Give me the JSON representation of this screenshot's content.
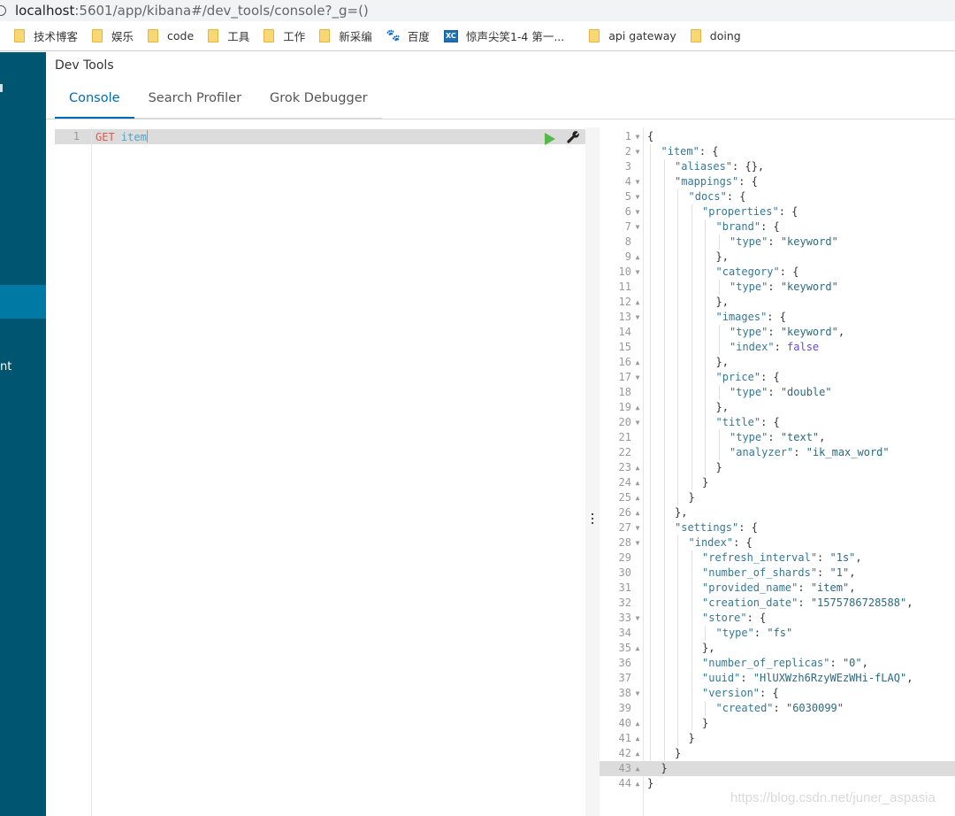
{
  "browser": {
    "url_host": "localhost",
    "url_path": ":5601/app/kibana#/dev_tools/console?_g=()",
    "bookmarks": [
      {
        "label": "技术博客",
        "icon": "folder-icon"
      },
      {
        "label": "娱乐",
        "icon": "folder-icon"
      },
      {
        "label": "code",
        "icon": "folder-icon"
      },
      {
        "label": "工具",
        "icon": "folder-icon"
      },
      {
        "label": "工作",
        "icon": "folder-icon"
      },
      {
        "label": "新采编",
        "icon": "folder-icon"
      },
      {
        "label": "百度",
        "icon": "baidu-paw-icon"
      },
      {
        "label": "惊声尖笑1-4 第一...",
        "icon": "xc-site-icon"
      },
      {
        "label": "api gateway",
        "icon": "folder-icon"
      },
      {
        "label": "doing",
        "icon": "folder-icon"
      }
    ]
  },
  "sidebar": {
    "partial_label": "nt",
    "accent": "#005571",
    "active_color": "#0079a5"
  },
  "header": {
    "title": "Dev Tools",
    "tabs": [
      {
        "label": "Console",
        "active": true
      },
      {
        "label": "Search Profiler",
        "active": false
      },
      {
        "label": "Grok Debugger",
        "active": false
      }
    ]
  },
  "editor": {
    "line_number": "1",
    "method": "GET",
    "path": "item",
    "run_icon": "play-icon",
    "settings_icon": "wrench-icon"
  },
  "output": {
    "lines": [
      {
        "n": "1",
        "fold": "down",
        "indent": 0,
        "parts": [
          [
            "p",
            "{"
          ]
        ]
      },
      {
        "n": "2",
        "fold": "down",
        "indent": 1,
        "parts": [
          [
            "k",
            "\"item\""
          ],
          [
            "p",
            ": {"
          ]
        ]
      },
      {
        "n": "3",
        "fold": "",
        "indent": 2,
        "parts": [
          [
            "k",
            "\"aliases\""
          ],
          [
            "p",
            ": {},"
          ]
        ]
      },
      {
        "n": "4",
        "fold": "down",
        "indent": 2,
        "parts": [
          [
            "k",
            "\"mappings\""
          ],
          [
            "p",
            ": {"
          ]
        ]
      },
      {
        "n": "5",
        "fold": "down",
        "indent": 3,
        "parts": [
          [
            "k",
            "\"docs\""
          ],
          [
            "p",
            ": {"
          ]
        ]
      },
      {
        "n": "6",
        "fold": "down",
        "indent": 4,
        "parts": [
          [
            "k",
            "\"properties\""
          ],
          [
            "p",
            ": {"
          ]
        ]
      },
      {
        "n": "7",
        "fold": "down",
        "indent": 5,
        "parts": [
          [
            "k",
            "\"brand\""
          ],
          [
            "p",
            ": {"
          ]
        ]
      },
      {
        "n": "8",
        "fold": "",
        "indent": 6,
        "parts": [
          [
            "k",
            "\"type\""
          ],
          [
            "p",
            ": "
          ],
          [
            "s",
            "\"keyword\""
          ]
        ]
      },
      {
        "n": "9",
        "fold": "up",
        "indent": 5,
        "parts": [
          [
            "p",
            "},"
          ]
        ]
      },
      {
        "n": "10",
        "fold": "down",
        "indent": 5,
        "parts": [
          [
            "k",
            "\"category\""
          ],
          [
            "p",
            ": {"
          ]
        ]
      },
      {
        "n": "11",
        "fold": "",
        "indent": 6,
        "parts": [
          [
            "k",
            "\"type\""
          ],
          [
            "p",
            ": "
          ],
          [
            "s",
            "\"keyword\""
          ]
        ]
      },
      {
        "n": "12",
        "fold": "up",
        "indent": 5,
        "parts": [
          [
            "p",
            "},"
          ]
        ]
      },
      {
        "n": "13",
        "fold": "down",
        "indent": 5,
        "parts": [
          [
            "k",
            "\"images\""
          ],
          [
            "p",
            ": {"
          ]
        ]
      },
      {
        "n": "14",
        "fold": "",
        "indent": 6,
        "parts": [
          [
            "k",
            "\"type\""
          ],
          [
            "p",
            ": "
          ],
          [
            "s",
            "\"keyword\""
          ],
          [
            "p",
            ","
          ]
        ]
      },
      {
        "n": "15",
        "fold": "",
        "indent": 6,
        "parts": [
          [
            "k",
            "\"index\""
          ],
          [
            "p",
            ": "
          ],
          [
            "b",
            "false"
          ]
        ]
      },
      {
        "n": "16",
        "fold": "up",
        "indent": 5,
        "parts": [
          [
            "p",
            "},"
          ]
        ]
      },
      {
        "n": "17",
        "fold": "down",
        "indent": 5,
        "parts": [
          [
            "k",
            "\"price\""
          ],
          [
            "p",
            ": {"
          ]
        ]
      },
      {
        "n": "18",
        "fold": "",
        "indent": 6,
        "parts": [
          [
            "k",
            "\"type\""
          ],
          [
            "p",
            ": "
          ],
          [
            "s",
            "\"double\""
          ]
        ]
      },
      {
        "n": "19",
        "fold": "up",
        "indent": 5,
        "parts": [
          [
            "p",
            "},"
          ]
        ]
      },
      {
        "n": "20",
        "fold": "down",
        "indent": 5,
        "parts": [
          [
            "k",
            "\"title\""
          ],
          [
            "p",
            ": {"
          ]
        ]
      },
      {
        "n": "21",
        "fold": "",
        "indent": 6,
        "parts": [
          [
            "k",
            "\"type\""
          ],
          [
            "p",
            ": "
          ],
          [
            "s",
            "\"text\""
          ],
          [
            "p",
            ","
          ]
        ]
      },
      {
        "n": "22",
        "fold": "",
        "indent": 6,
        "parts": [
          [
            "k",
            "\"analyzer\""
          ],
          [
            "p",
            ": "
          ],
          [
            "s",
            "\"ik_max_word\""
          ]
        ]
      },
      {
        "n": "23",
        "fold": "up",
        "indent": 5,
        "parts": [
          [
            "p",
            "}"
          ]
        ]
      },
      {
        "n": "24",
        "fold": "up",
        "indent": 4,
        "parts": [
          [
            "p",
            "}"
          ]
        ]
      },
      {
        "n": "25",
        "fold": "up",
        "indent": 3,
        "parts": [
          [
            "p",
            "}"
          ]
        ]
      },
      {
        "n": "26",
        "fold": "up",
        "indent": 2,
        "parts": [
          [
            "p",
            "},"
          ]
        ]
      },
      {
        "n": "27",
        "fold": "down",
        "indent": 2,
        "parts": [
          [
            "k",
            "\"settings\""
          ],
          [
            "p",
            ": {"
          ]
        ]
      },
      {
        "n": "28",
        "fold": "down",
        "indent": 3,
        "parts": [
          [
            "k",
            "\"index\""
          ],
          [
            "p",
            ": {"
          ]
        ]
      },
      {
        "n": "29",
        "fold": "",
        "indent": 4,
        "parts": [
          [
            "k",
            "\"refresh_interval\""
          ],
          [
            "p",
            ": "
          ],
          [
            "s",
            "\"1s\""
          ],
          [
            "p",
            ","
          ]
        ]
      },
      {
        "n": "30",
        "fold": "",
        "indent": 4,
        "parts": [
          [
            "k",
            "\"number_of_shards\""
          ],
          [
            "p",
            ": "
          ],
          [
            "s",
            "\"1\""
          ],
          [
            "p",
            ","
          ]
        ]
      },
      {
        "n": "31",
        "fold": "",
        "indent": 4,
        "parts": [
          [
            "k",
            "\"provided_name\""
          ],
          [
            "p",
            ": "
          ],
          [
            "s",
            "\"item\""
          ],
          [
            "p",
            ","
          ]
        ]
      },
      {
        "n": "32",
        "fold": "",
        "indent": 4,
        "parts": [
          [
            "k",
            "\"creation_date\""
          ],
          [
            "p",
            ": "
          ],
          [
            "s",
            "\"1575786728588\""
          ],
          [
            "p",
            ","
          ]
        ]
      },
      {
        "n": "33",
        "fold": "down",
        "indent": 4,
        "parts": [
          [
            "k",
            "\"store\""
          ],
          [
            "p",
            ": {"
          ]
        ]
      },
      {
        "n": "34",
        "fold": "",
        "indent": 5,
        "parts": [
          [
            "k",
            "\"type\""
          ],
          [
            "p",
            ": "
          ],
          [
            "s",
            "\"fs\""
          ]
        ]
      },
      {
        "n": "35",
        "fold": "up",
        "indent": 4,
        "parts": [
          [
            "p",
            "},"
          ]
        ]
      },
      {
        "n": "36",
        "fold": "",
        "indent": 4,
        "parts": [
          [
            "k",
            "\"number_of_replicas\""
          ],
          [
            "p",
            ": "
          ],
          [
            "s",
            "\"0\""
          ],
          [
            "p",
            ","
          ]
        ]
      },
      {
        "n": "37",
        "fold": "",
        "indent": 4,
        "parts": [
          [
            "k",
            "\"uuid\""
          ],
          [
            "p",
            ": "
          ],
          [
            "s",
            "\"HlUXWzh6RzyWEzWHi-fLAQ\""
          ],
          [
            "p",
            ","
          ]
        ]
      },
      {
        "n": "38",
        "fold": "down",
        "indent": 4,
        "parts": [
          [
            "k",
            "\"version\""
          ],
          [
            "p",
            ": {"
          ]
        ]
      },
      {
        "n": "39",
        "fold": "",
        "indent": 5,
        "parts": [
          [
            "k",
            "\"created\""
          ],
          [
            "p",
            ": "
          ],
          [
            "s",
            "\"6030099\""
          ]
        ]
      },
      {
        "n": "40",
        "fold": "up",
        "indent": 4,
        "parts": [
          [
            "p",
            "}"
          ]
        ]
      },
      {
        "n": "41",
        "fold": "up",
        "indent": 3,
        "parts": [
          [
            "p",
            "}"
          ]
        ]
      },
      {
        "n": "42",
        "fold": "up",
        "indent": 2,
        "parts": [
          [
            "p",
            "}"
          ]
        ]
      },
      {
        "n": "43",
        "fold": "up",
        "indent": 1,
        "parts": [
          [
            "p",
            "}"
          ]
        ]
      },
      {
        "n": "44",
        "fold": "up",
        "indent": 0,
        "parts": [
          [
            "p",
            "}"
          ]
        ]
      }
    ],
    "highlighted_line": "43"
  },
  "watermark": "https://blog.csdn.net/juner_aspasia"
}
